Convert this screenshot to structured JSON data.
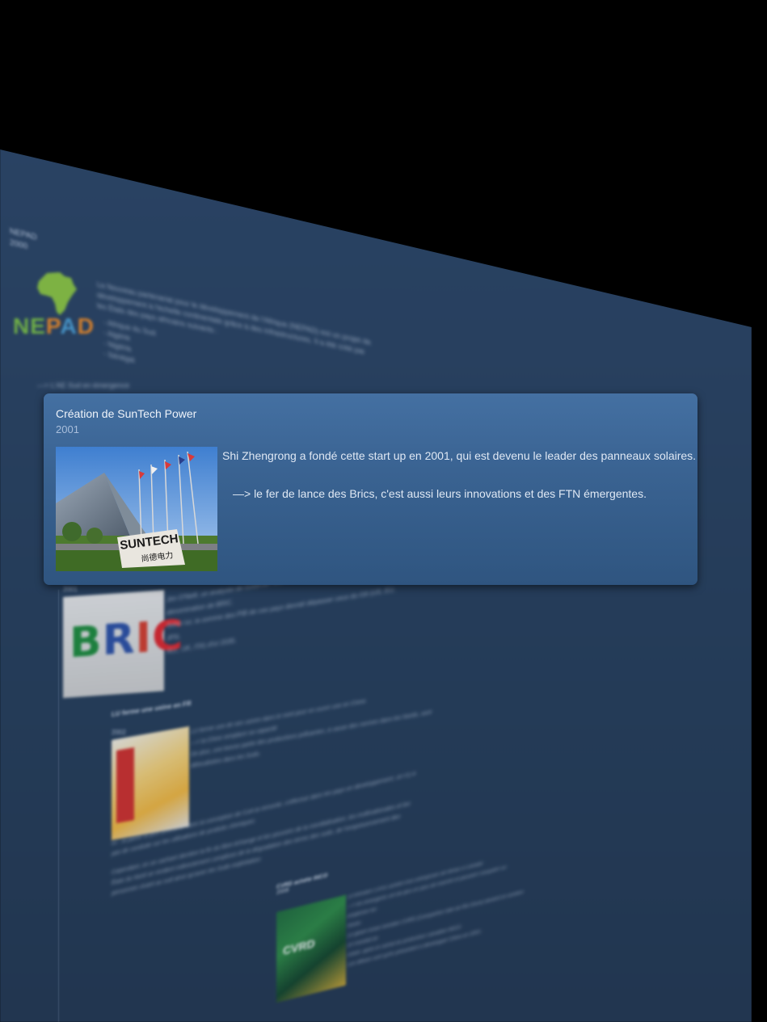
{
  "background": {
    "nepad": {
      "label": "NEPAD",
      "year": "2000",
      "logo_text": "NEPAD",
      "description": "Le Nouveau partenariat pour le développement de l'Afrique (NEPAD) est un projet de développement à l'échelle continentale grâce à des infrastructures. Il a été créé par les États des pays africains suivants :",
      "countries": [
        "Afrique du Sud",
        "Algérie",
        "Nigéria",
        "Sénégal"
      ],
      "arrow_peek": "—> L'AE Sud en émergence"
    },
    "bric": {
      "year": "2001",
      "logo_word": "BRIC",
      "text_lines": [
        "Jim O'Neill, un analyste de Goldman Sachs, regroupe à peine tous la dénomination de BRIC.",
        "Selon lui, la somme des PIB de ces pays devrait dépasser ceux du G6 (US, EU, JPN,",
        "ALL, UK, ITA) d'ici 2035."
      ]
    },
    "lu": {
      "title": "LU ferme une usine en FR",
      "year": "2002",
      "text_lines": [
        "LU ferme une de ses usines dans le nord pour en ouvrir une en Chine.",
        "—> la Chine remplace sa capacité",
        "De plus, une bonne partie des productions polluantes, à cause des normes dans les Nords, sont",
        "délocalisées dans les Suds."
      ],
      "paragraph_1": "Ici : la partie la plus polluante dans la conception de CoA la remonte, s'effectue dans les pays en développement, ce n'y a pas de conduite sur les utilisations de produits chimiques.",
      "paragraph_2": "Cependant, en se cachant derrière la fin du libre-échange et les pouvoirs de la mondialisation, les multinationales et les États du Nord se rendent indirectement complices de la dégradation des terres des suds, de l'empoisonnement des personnes vivant au sud ainsi qu'avec les Suds exploitation."
    },
    "cvrd": {
      "title": "CVRD achète INCO",
      "year": "2006",
      "image_label": "CVRD",
      "text_lines": [
        "Le brésilien CVRD achète trois entreprises de Minas à Canada",
        "—> les émergents ont de plus en plus de marché et peuvent s'acquérir ou empêcher les",
        "Nords.",
        "Le géant minier brésilien CVRD (Companhia Vale do Rio Doce) devient le numéro un mondial du",
        "nickel, après le rachat du producteur canadien INCO.",
        "Les débuts sont qu'ils présentent à développer Chine en 2001."
      ]
    }
  },
  "card": {
    "title": "Création de SunTech Power",
    "year": "2001",
    "image_caption": "SUNTECH",
    "image_caption_cn": "尚德电力",
    "text_1": "Shi Zhengrong a fondé cette start up en 2001, qui est devenu le leader des panneaux solaires.",
    "text_2": "—> le fer de lance des Brics, c'est aussi leurs innovations et des FTN émergentes."
  },
  "colors": {
    "page_bg": "#000000",
    "panel_bg": "#2a4466",
    "card_top": "#4470a2",
    "card_bottom": "#2f5580",
    "text": "#dfe8f4",
    "muted": "#a9bedb"
  }
}
